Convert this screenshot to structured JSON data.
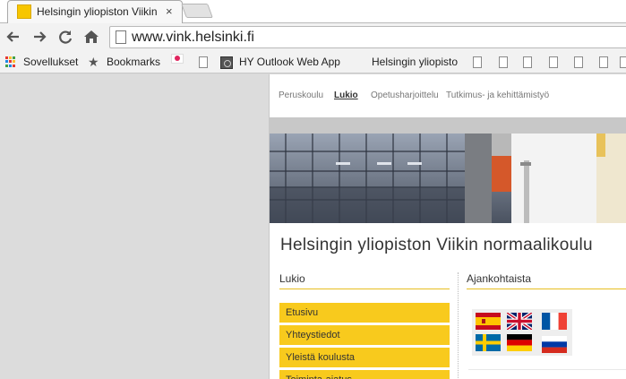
{
  "browser": {
    "tab": {
      "title": "Helsingin yliopiston Viikin",
      "close": "×"
    },
    "url": "www.vink.helsinki.fi",
    "bookmarks": {
      "apps": "Sovellukset",
      "bookmarks": "Bookmarks",
      "owa": "HY Outlook Web App",
      "hy": "Helsingin yliopisto"
    }
  },
  "site": {
    "nav": [
      "Peruskoulu",
      "Lukio",
      "Opetusharjoittelu",
      "Tutkimus- ja kehittämistyö"
    ],
    "active_nav": "Lukio",
    "title": "Helsingin yliopiston Viikin normaalikoulu",
    "left_heading": "Lukio",
    "right_heading": "Ajankohtaista",
    "menu": [
      "Etusivu",
      "Yhteystiedot",
      "Yleistä koulusta",
      "Toiminta-ajatus"
    ],
    "languages": [
      "spanish-flag-icon",
      "uk-flag-icon",
      "french-flag-icon",
      "swedish-flag-icon",
      "german-flag-icon",
      "russian-flag-icon"
    ],
    "accent_color": "#f8ca1d"
  }
}
